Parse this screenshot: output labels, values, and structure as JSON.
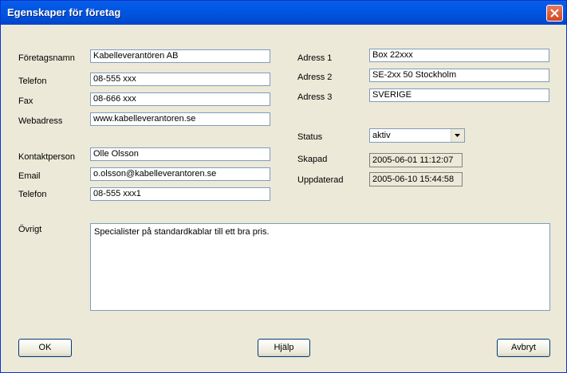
{
  "window": {
    "title": "Egenskaper för företag"
  },
  "company": {
    "name_label": "Företagsnamn",
    "name_value": "Kabelleverantören AB",
    "phone_label": "Telefon",
    "phone_value": "08-555 xxx",
    "fax_label": "Fax",
    "fax_value": "08-666 xxx",
    "web_label": "Webadress",
    "web_value": "www.kabelleverantoren.se"
  },
  "contact": {
    "person_label": "Kontaktperson",
    "person_value": "Olle Olsson",
    "email_label": "Email",
    "email_value": "o.olsson@kabelleverantoren.se",
    "phone_label": "Telefon",
    "phone_value": "08-555 xxx1"
  },
  "address": {
    "a1_label": "Adress 1",
    "a1_value": "Box 22xxx",
    "a2_label": "Adress 2",
    "a2_value": "SE-2xx 50 Stockholm",
    "a3_label": "Adress 3",
    "a3_value": "SVERIGE"
  },
  "status": {
    "status_label": "Status",
    "status_value": "aktiv",
    "created_label": "Skapad",
    "created_value": "2005-06-01 11:12:07",
    "updated_label": "Uppdaterad",
    "updated_value": "2005-06-10 15:44:58"
  },
  "notes": {
    "label": "Övrigt",
    "value": "Specialister på standardkablar till ett bra pris."
  },
  "buttons": {
    "ok": "OK",
    "help": "Hjälp",
    "cancel": "Avbryt"
  },
  "icons": {
    "close": "close-icon",
    "dropdown": "chevron-down-icon"
  }
}
